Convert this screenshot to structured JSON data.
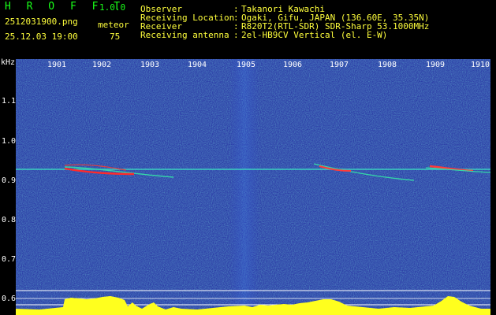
{
  "app": {
    "name": "H R O F F T",
    "version": "1.0.0"
  },
  "file": {
    "filename": "2512031900.png",
    "datetime": "25.12.03 19:00"
  },
  "counter": {
    "label": "meteor",
    "value": "75"
  },
  "info": [
    {
      "label": "Observer",
      "value": "Takanori Kawachi"
    },
    {
      "label": "Receiving Location",
      "value": "Ogaki, Gifu, JAPAN (136.60E, 35.35N)"
    },
    {
      "label": "Receiver",
      "value": "R820T2(RTL-SDR) SDR-Sharp 53.1000MHz"
    },
    {
      "label": "Receiving antenna",
      "value": "2el-HB9CV Vertical (el. E-W)"
    }
  ],
  "axes": {
    "y_unit": "kHz",
    "y_ticks": [
      "1.1",
      "1.0",
      "0.9",
      "0.8",
      "0.7",
      "0.6"
    ],
    "x_ticks": [
      "1901",
      "1902",
      "1903",
      "1904",
      "1905",
      "1906",
      "1907",
      "1908",
      "1909",
      "1910"
    ]
  },
  "colors": {
    "bg": "#000000",
    "plot_bg": "#1a2a99",
    "label": "#ffff3c",
    "brand": "#19ff19",
    "trace": "#3ad0c0"
  }
}
